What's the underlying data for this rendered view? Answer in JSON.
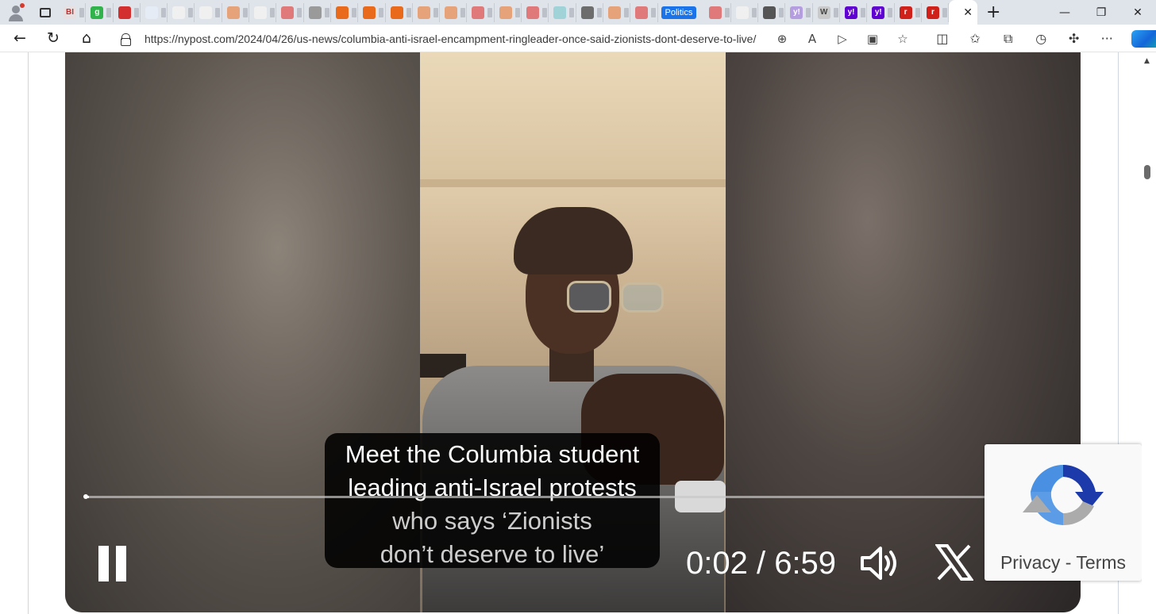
{
  "browser": {
    "tab_groups": {
      "politics_label": "Politics"
    },
    "favicons": [
      {
        "name": "bi-favicon",
        "text": "BI",
        "color": "#e8e0e0",
        "fg": "#b33"
      },
      {
        "name": "g-favicon",
        "text": "g",
        "color": "#2fb34a",
        "fg": "#fff"
      },
      {
        "name": "red-favicon",
        "text": "",
        "color": "#d32f2f",
        "fg": "#fff"
      },
      {
        "name": "search-favicon",
        "text": "",
        "color": "#e6ecf5",
        "fg": "#3a70c0"
      },
      {
        "name": "doc-favicon",
        "text": "",
        "color": "#f0f0f0",
        "fg": "#666"
      },
      {
        "name": "slash-favicon",
        "text": "",
        "color": "#f0f0f0",
        "fg": "#444"
      },
      {
        "name": "bookmark-favicon",
        "text": "",
        "color": "#e6a37a",
        "fg": "#fff"
      },
      {
        "name": "doc-favicon",
        "text": "",
        "color": "#f0f0f0",
        "fg": "#666"
      },
      {
        "name": "youtube-favicon",
        "text": "",
        "color": "#e07a7a",
        "fg": "#fff"
      },
      {
        "name": "image-favicon",
        "text": "",
        "color": "#9a9a9a",
        "fg": "#fff"
      },
      {
        "name": "bookmark-favicon",
        "text": "",
        "color": "#e86a1a",
        "fg": "#fff"
      },
      {
        "name": "bookmark-favicon",
        "text": "",
        "color": "#e86a1a",
        "fg": "#fff"
      },
      {
        "name": "bookmark-favicon",
        "text": "",
        "color": "#e86a1a",
        "fg": "#fff"
      },
      {
        "name": "bookmark-favicon",
        "text": "",
        "color": "#e6a37a",
        "fg": "#fff"
      },
      {
        "name": "bookmark-favicon",
        "text": "",
        "color": "#e6a37a",
        "fg": "#fff"
      },
      {
        "name": "youtube-favicon",
        "text": "",
        "color": "#e07a7a",
        "fg": "#fff"
      },
      {
        "name": "bookmark-favicon",
        "text": "",
        "color": "#e6a37a",
        "fg": "#fff"
      },
      {
        "name": "youtube-favicon",
        "text": "",
        "color": "#e07a7a",
        "fg": "#fff"
      },
      {
        "name": "cloud-favicon",
        "text": "",
        "color": "#9fd3d8",
        "fg": "#fff"
      },
      {
        "name": "image-favicon",
        "text": "",
        "color": "#6d6d6d",
        "fg": "#fff"
      },
      {
        "name": "bookmark-favicon",
        "text": "",
        "color": "#e6a37a",
        "fg": "#fff"
      },
      {
        "name": "youtube-favicon",
        "text": "",
        "color": "#e07a7a",
        "fg": "#fff"
      }
    ],
    "favicons_after": [
      {
        "name": "youtube-favicon",
        "text": "",
        "color": "#e07a7a",
        "fg": "#fff"
      },
      {
        "name": "doc-favicon",
        "text": "",
        "color": "#f0f0f0",
        "fg": "#666"
      },
      {
        "name": "image-favicon",
        "text": "",
        "color": "#555",
        "fg": "#fff"
      },
      {
        "name": "yahoo-favicon",
        "text": "y!",
        "color": "#b59ee0",
        "fg": "#fff"
      },
      {
        "name": "wp-favicon",
        "text": "W",
        "color": "#c9c9c9",
        "fg": "#444"
      },
      {
        "name": "yahoo-favicon",
        "text": "y!",
        "color": "#5f01d1",
        "fg": "#fff"
      },
      {
        "name": "yahoo-favicon",
        "text": "y!",
        "color": "#5f01d1",
        "fg": "#fff"
      },
      {
        "name": "r-favicon",
        "text": "r",
        "color": "#d0201a",
        "fg": "#fff"
      },
      {
        "name": "r-favicon",
        "text": "r",
        "color": "#d0201a",
        "fg": "#fff"
      }
    ],
    "url": "https://nypost.com/2024/04/26/us-news/columbia-anti-israel-encampment-ringleader-once-said-zionists-dont-deserve-to-live/"
  },
  "video": {
    "caption_lines": [
      "Meet the Columbia student",
      "leading anti-Israel protests",
      "who says ‘Zionists",
      "don’t deserve to live’"
    ],
    "time_display": "0:02 / 6:59",
    "progress": 0.005
  },
  "recaptcha": {
    "privacy": "Privacy",
    "separator": "-",
    "terms": "Terms"
  }
}
